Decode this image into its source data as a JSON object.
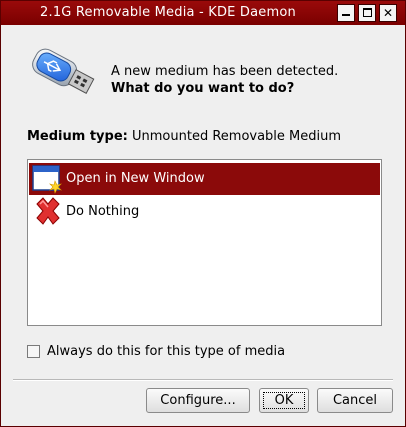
{
  "window": {
    "title": "2.1G Removable Media - KDE Daemon",
    "accent_color": "#8b0000"
  },
  "titlebar_buttons": {
    "minimize_icon": "minimize-icon",
    "maximize_icon": "maximize-icon",
    "close_icon": "close-icon",
    "close_glyph": "✕"
  },
  "header": {
    "icon": "usb-drive-icon",
    "line1": "A new medium has been detected.",
    "line2": "What do you want to do?"
  },
  "medium": {
    "label": "Medium type:",
    "value": "Unmounted Removable Medium"
  },
  "actions": [
    {
      "label": "Open in New Window",
      "icon": "new-window-icon",
      "selected": true
    },
    {
      "label": "Do Nothing",
      "icon": "red-x-icon",
      "selected": false
    }
  ],
  "always_checkbox": {
    "label": "Always do this for this type of media",
    "checked": false
  },
  "buttons": {
    "configure": "Configure...",
    "ok": "OK",
    "cancel": "Cancel"
  }
}
